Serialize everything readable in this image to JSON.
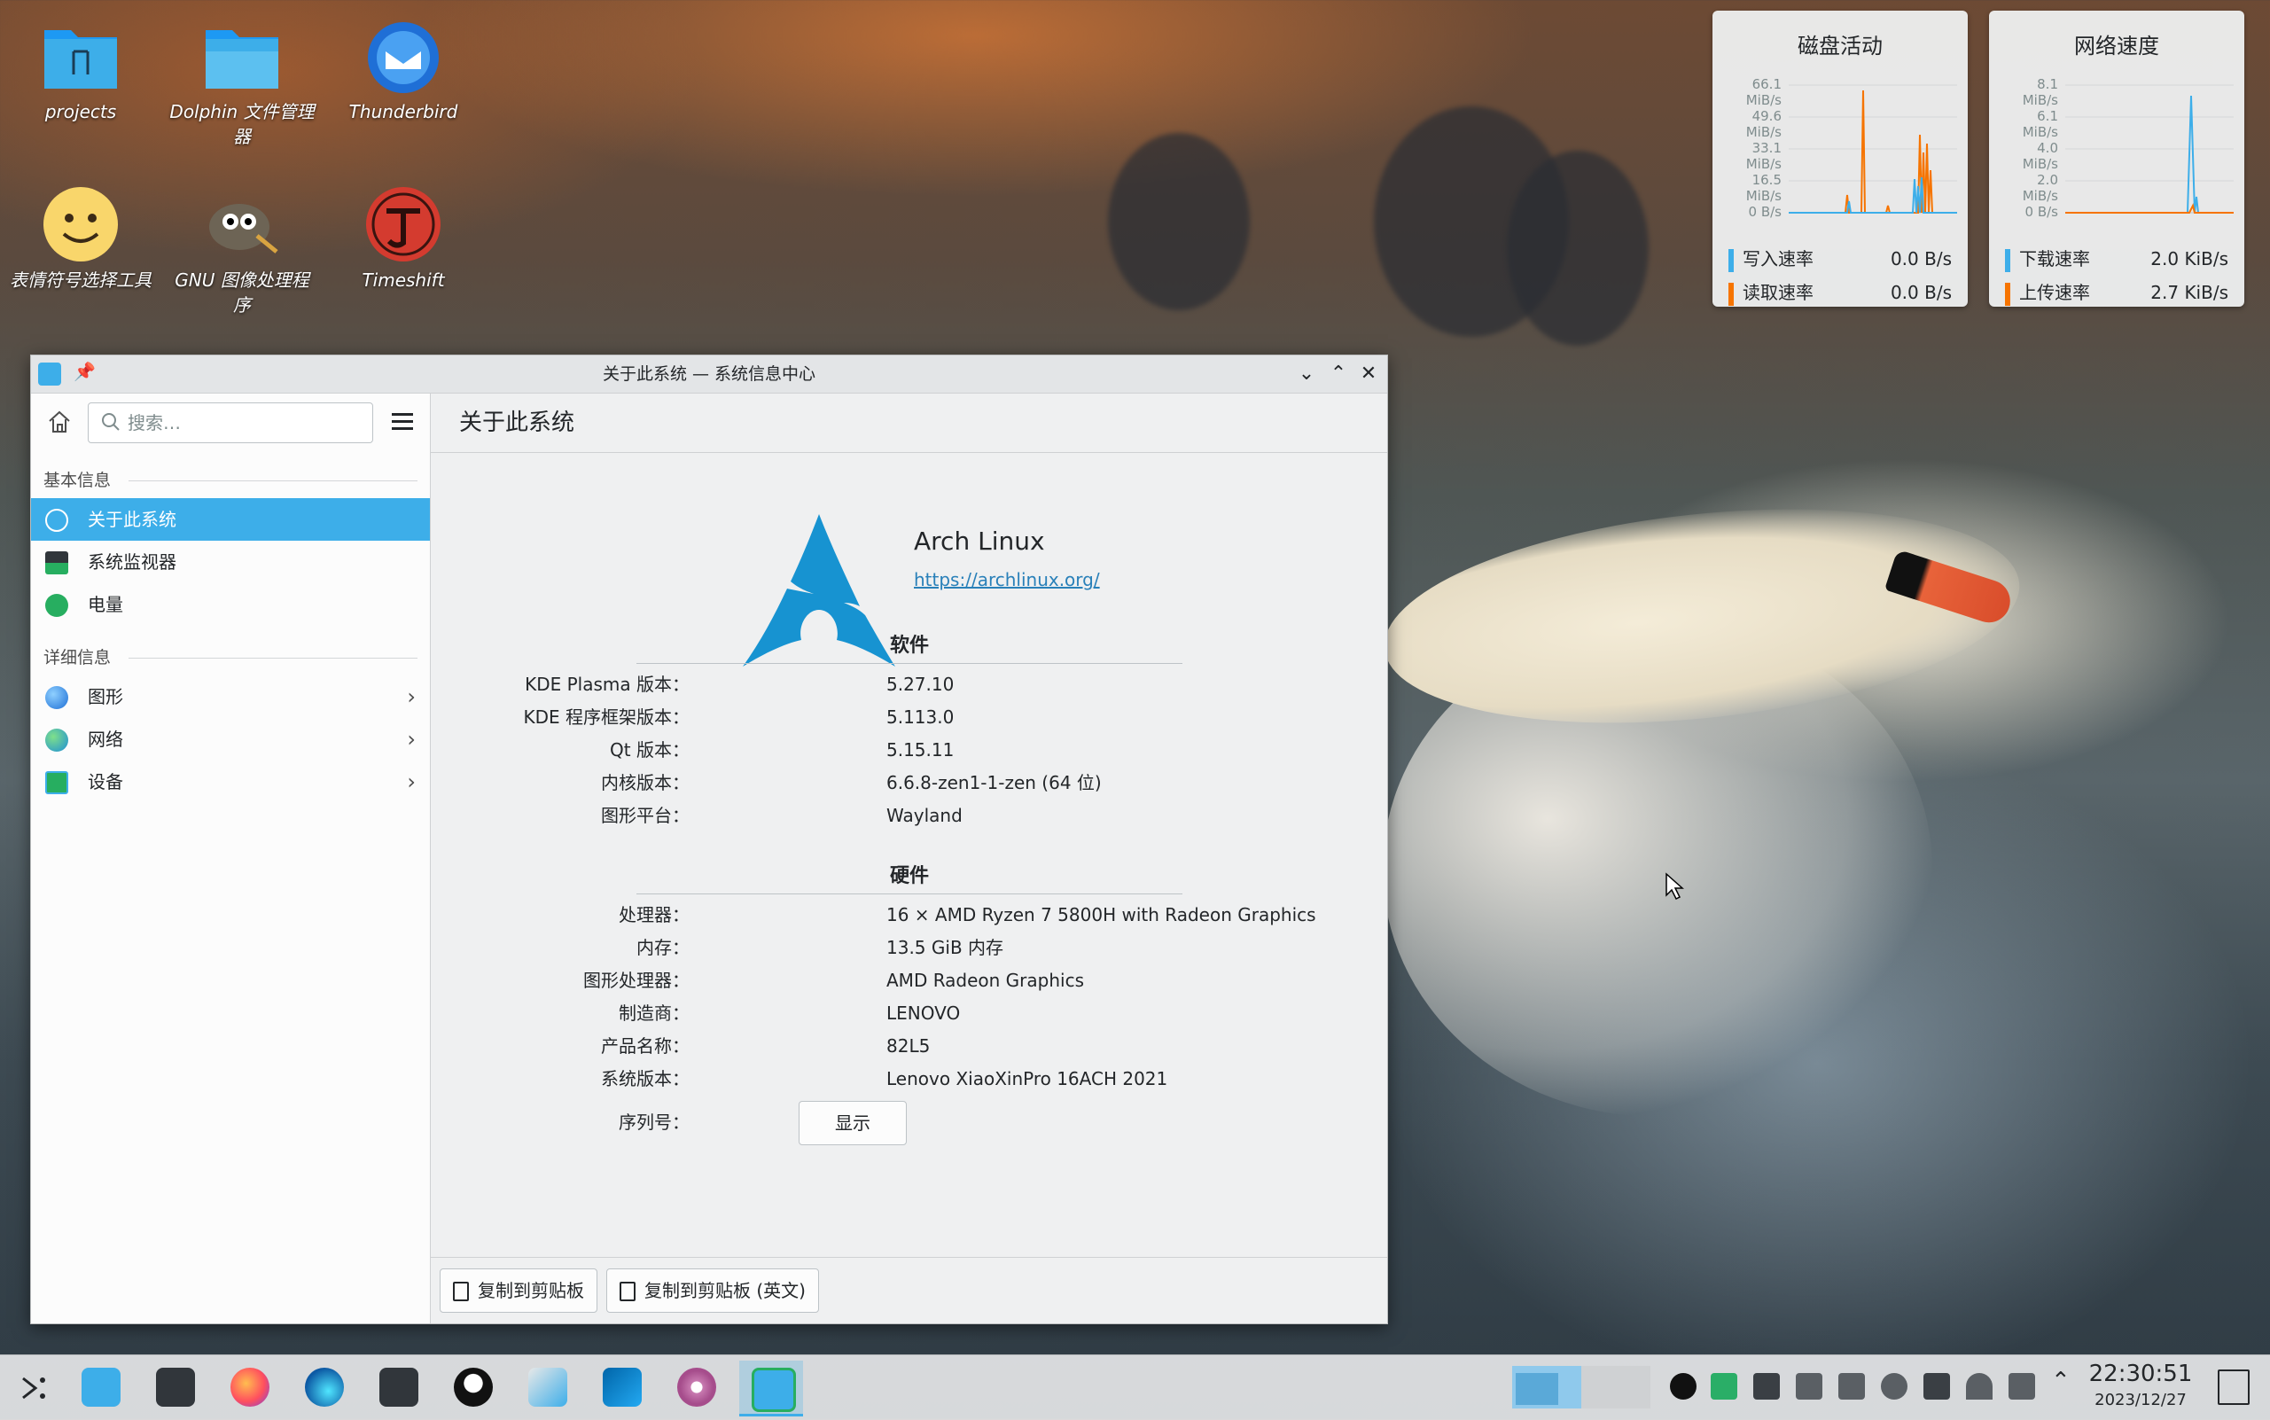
{
  "desktop": {
    "icons": [
      {
        "label": "projects"
      },
      {
        "label": "Dolphin 文件管理器"
      },
      {
        "label": "Thunderbird"
      },
      {
        "label": "表情符号选择工具"
      },
      {
        "label": "GNU 图像处理程序"
      },
      {
        "label": "Timeshift"
      }
    ]
  },
  "disk_widget": {
    "title": "磁盘活动",
    "y_ticks": [
      "66.1 MiB/s",
      "49.6 MiB/s",
      "33.1 MiB/s",
      "16.5 MiB/s",
      "0 B/s"
    ],
    "legend": [
      {
        "label": "写入速率",
        "value": "0.0 B/s",
        "color": "#3daee9"
      },
      {
        "label": "读取速率",
        "value": "0.0 B/s",
        "color": "#f67400"
      }
    ]
  },
  "net_widget": {
    "title": "网络速度",
    "y_ticks": [
      "8.1 MiB/s",
      "6.1 MiB/s",
      "4.0 MiB/s",
      "2.0 MiB/s",
      "0 B/s"
    ],
    "legend": [
      {
        "label": "下载速率",
        "value": "2.0 KiB/s",
        "color": "#3daee9"
      },
      {
        "label": "上传速率",
        "value": "2.7 KiB/s",
        "color": "#f67400"
      }
    ]
  },
  "window": {
    "title": "关于此系统 — 系统信息中心",
    "search_placeholder": "搜索…",
    "page_title": "关于此系统",
    "sidebar": {
      "section1": "基本信息",
      "items1": [
        {
          "label": "关于此系统",
          "icon": "info-icon"
        },
        {
          "label": "系统监视器",
          "icon": "monitor-icon"
        },
        {
          "label": "电量",
          "icon": "battery-icon"
        }
      ],
      "section2": "详细信息",
      "items2": [
        {
          "label": "图形",
          "icon": "graphics-icon"
        },
        {
          "label": "网络",
          "icon": "network-icon"
        },
        {
          "label": "设备",
          "icon": "devices-icon"
        }
      ]
    },
    "distro": {
      "name": "Arch Linux",
      "url": "https://archlinux.org/"
    },
    "software": {
      "title": "软件",
      "rows": [
        {
          "k": "KDE Plasma 版本：",
          "v": "5.27.10"
        },
        {
          "k": "KDE 程序框架版本：",
          "v": "5.113.0"
        },
        {
          "k": "Qt 版本：",
          "v": "5.15.11"
        },
        {
          "k": "内核版本：",
          "v": "6.6.8-zen1-1-zen (64 位)"
        },
        {
          "k": "图形平台：",
          "v": "Wayland"
        }
      ]
    },
    "hardware": {
      "title": "硬件",
      "rows": [
        {
          "k": "处理器：",
          "v": "16 × AMD Ryzen 7 5800H with Radeon Graphics"
        },
        {
          "k": "内存：",
          "v": "13.5 GiB 内存"
        },
        {
          "k": "图形处理器：",
          "v": "AMD Radeon Graphics"
        },
        {
          "k": "制造商：",
          "v": "LENOVO"
        },
        {
          "k": "产品名称：",
          "v": "82L5"
        },
        {
          "k": "系统版本：",
          "v": "Lenovo XiaoXinPro 16ACH 2021"
        }
      ],
      "serial_label": "序列号：",
      "show_label": "显示"
    },
    "footer": {
      "copy": "复制到剪贴板",
      "copy_en": "复制到剪贴板 (英文)"
    }
  },
  "taskbar": {
    "clock_time": "22:30:51",
    "clock_date": "2023/12/27"
  },
  "colors": {
    "accent": "#3daee9",
    "upload": "#f67400"
  }
}
